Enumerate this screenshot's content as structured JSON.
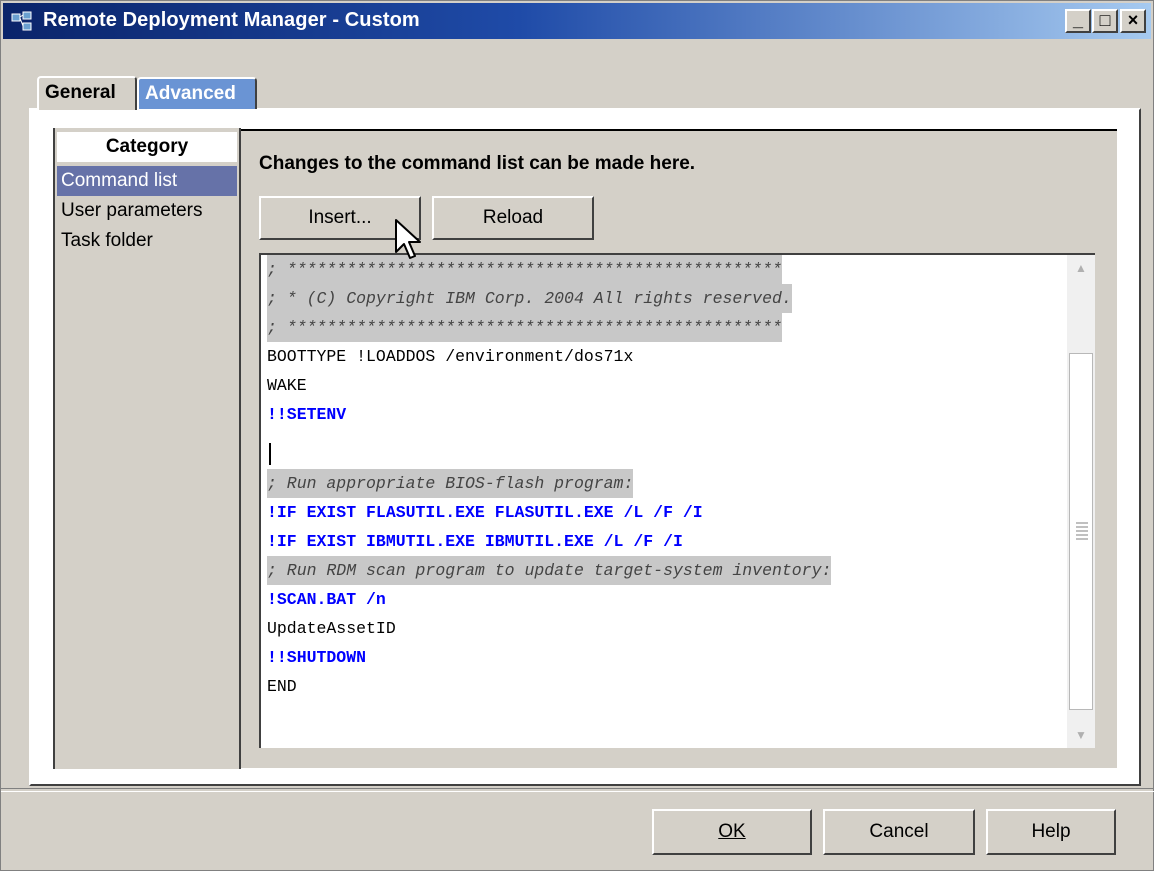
{
  "window": {
    "title": "Remote Deployment Manager - Custom",
    "controls": {
      "minimize": "_",
      "maximize": "□",
      "close": "×"
    }
  },
  "tabs": [
    {
      "label": "General",
      "active": true
    },
    {
      "label": "Advanced",
      "active": false
    }
  ],
  "category": {
    "header": "Category",
    "items": [
      {
        "label": "Command list",
        "selected": true
      },
      {
        "label": "User parameters",
        "selected": false
      },
      {
        "label": "Task folder",
        "selected": false
      }
    ]
  },
  "content": {
    "description": "Changes to the command list can be made here.",
    "insert_button": "Insert...",
    "reload_button": "Reload"
  },
  "editor": {
    "lines": [
      {
        "text": "; **************************************************",
        "kind": "comment"
      },
      {
        "text": "; * (C) Copyright IBM Corp. 2004 All rights reserved.",
        "kind": "comment"
      },
      {
        "text": "; **************************************************",
        "kind": "comment"
      },
      {
        "text": "BOOTTYPE !LOADDOS /environment/dos71x",
        "kind": "plain"
      },
      {
        "text": "WAKE",
        "kind": "plain"
      },
      {
        "text": "!!SETENV",
        "kind": "cmd"
      },
      {
        "text": "",
        "kind": "plain"
      },
      {
        "text": "; Run appropriate BIOS-flash program:",
        "kind": "comment"
      },
      {
        "text": "!IF EXIST FLASUTIL.EXE FLASUTIL.EXE /L /F /I",
        "kind": "cmd"
      },
      {
        "text": "!IF EXIST IBMUTIL.EXE IBMUTIL.EXE /L /F /I",
        "kind": "cmd"
      },
      {
        "text": "; Run RDM scan program to update target-system inventory:",
        "kind": "comment"
      },
      {
        "text": "!SCAN.BAT /n",
        "kind": "cmd"
      },
      {
        "text": "UpdateAssetID",
        "kind": "plain"
      },
      {
        "text": "!!SHUTDOWN",
        "kind": "cmd"
      },
      {
        "text": "END",
        "kind": "plain"
      }
    ]
  },
  "footer": {
    "ok_button": "OK",
    "cancel_button": "Cancel",
    "help_button": "Help"
  },
  "colors": {
    "title_bar": "#0a246a",
    "tab_advanced": "#6a94d4",
    "selected_item": "#6672a8",
    "command_text": "#0000ff"
  },
  "icons": {
    "app": "app-icon",
    "scroll_up": "scroll-up-arrow-icon",
    "scroll_down": "scroll-down-arrow-icon",
    "pointer": "mouse-pointer-icon"
  }
}
